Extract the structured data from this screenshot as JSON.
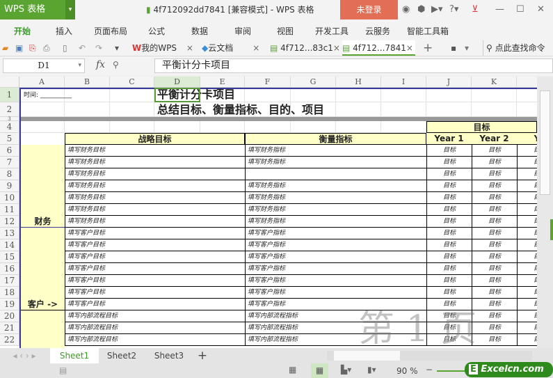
{
  "app": {
    "logo": "WPS 表格",
    "title": "4f712092dd7841 [兼容模式] - WPS 表格",
    "login": "未登录"
  },
  "menu": [
    "开始",
    "插入",
    "页面布局",
    "公式",
    "数据",
    "审阅",
    "视图",
    "开发工具",
    "云服务",
    "智能工具箱"
  ],
  "doc_tabs": [
    "我的WPS",
    "云文档",
    "4f712...83c1",
    "4f712...7841"
  ],
  "search_cmd": "点此查找命令",
  "formula": {
    "cell_ref": "D1",
    "fx": "fx",
    "content": "平衡计分卡项目"
  },
  "columns": [
    "A",
    "B",
    "C",
    "D",
    "E",
    "F",
    "G",
    "H",
    "I",
    "J",
    "K"
  ],
  "rows": [
    "1",
    "2",
    "3",
    "4",
    "5",
    "6",
    "7",
    "8",
    "9",
    "10",
    "11",
    "12",
    "13",
    "14",
    "15",
    "16",
    "17",
    "18",
    "19",
    "20",
    "21",
    "22"
  ],
  "sheet": {
    "time_label": "时间: __________",
    "title": "平衡计分卡项目",
    "subtitle": "总结目标、衡量指标、目的、项目",
    "header_strategy": "战略目标",
    "header_measure": "衡量指标",
    "header_target": "目标",
    "years": [
      "Year 1",
      "Year 2",
      "Ye"
    ],
    "cat_finance": "财务",
    "cat_customer": "客户 ->",
    "target_text": "目标",
    "strategy": [
      "填写财务目标",
      "填写财务目标",
      "填写财务目标",
      "填写财务目标",
      "填写财务目标",
      "填写财务目标",
      "填写财务目标",
      "填写客户目标",
      "填写客户目标",
      "填写客户目标",
      "填写客户目标",
      "填写客户目标",
      "填写客户目标",
      "填写客户目标",
      "填写内部流程目标",
      "填写内部流程目标",
      "填写内部流程目标"
    ],
    "measure": [
      "填写财务指标",
      "填写财务指标",
      "",
      "填写财务指标",
      "填写财务指标",
      "填写财务指标",
      "填写财务指标",
      "填写客户指标",
      "填写客户指标",
      "填写客户指标",
      "填写客户指标",
      "填写客户指标",
      "填写客户指标",
      "填写客户指标",
      "填写内部流程指标",
      "填写内部流程指标",
      "填写内部流程指标"
    ],
    "watermark": "第 1 页"
  },
  "sheet_tabs": [
    "Sheet1",
    "Sheet2",
    "Sheet3"
  ],
  "status": {
    "zoom": "90 %",
    "brand": "Excelcn.com"
  }
}
